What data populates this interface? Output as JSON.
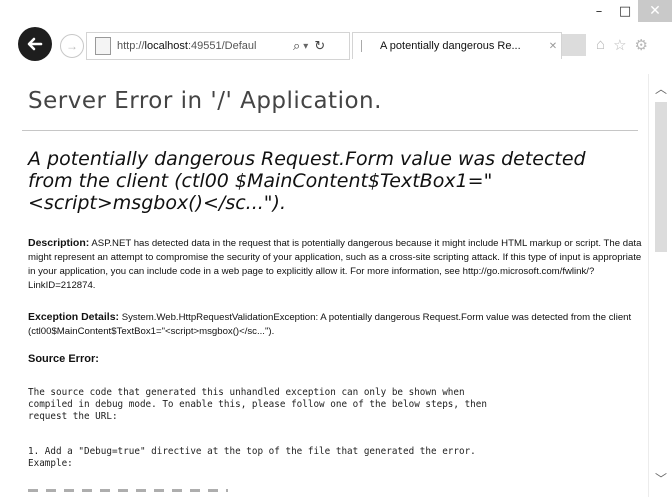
{
  "browser": {
    "window_controls": {
      "minimize": "–",
      "maximize": "□",
      "close": "✕"
    },
    "address_bar": {
      "url_prefix": "http://",
      "url_host": "localhost",
      "url_rest": ":49551/Defaul",
      "search_glyph": "⌕",
      "dropdown_glyph": "▾",
      "refresh_glyph": "↻"
    },
    "tab": {
      "title": "A potentially dangerous Re...",
      "close_glyph": "✕"
    },
    "toolbar_icons": [
      "⌂",
      "☆",
      "⚙"
    ]
  },
  "page": {
    "server_error_title": "Server Error in '/' Application.",
    "error_heading": "A potentially dangerous Request.Form value was detected from the client (ctl00 $MainContent$TextBox1=\"<script>msgbox()</sc...\").",
    "description_label": "Description:",
    "description_text": "ASP.NET has detected data in the request that is potentially dangerous because it might include HTML markup or script. The data might represent an attempt to compromise the security of your application, such as a cross-site scripting attack. If this type of input is appropriate in your application, you can include code in a web page to explicitly allow it. For more information, see http://go.microsoft.com/fwlink/?LinkID=212874.",
    "exception_label": "Exception Details:",
    "exception_text": "System.Web.HttpRequestValidationException: A potentially dangerous Request.Form value was detected from the client (ctl00$MainContent$TextBox1=\"<script>msgbox()</sc...\").",
    "source_error_label": "Source Error:",
    "source_text": "The source code that generated this unhandled exception can only be shown when\ncompiled in debug mode. To enable this, please follow one of the below steps, then\nrequest the URL:",
    "step_one_text": "1. Add a \"Debug=true\" directive at the top of the file that generated the error.\nExample:"
  },
  "scrollbar": {
    "up_glyph": "︿",
    "down_glyph": "﹀"
  }
}
